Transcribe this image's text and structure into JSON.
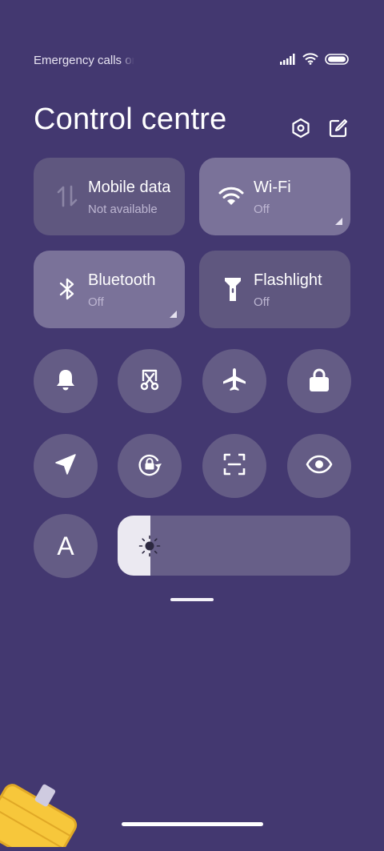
{
  "status_bar": {
    "carrier_text": "Emergency calls only",
    "icons": [
      "signal-icon",
      "wifi-icon",
      "battery-icon"
    ]
  },
  "header": {
    "title": "Control centre",
    "settings_icon": "settings-hexagon-icon",
    "edit_icon": "edit-icon"
  },
  "tiles": [
    {
      "label": "Mobile data",
      "status": "Not available",
      "icon": "mobile-data-icon",
      "active": false
    },
    {
      "label": "Wi-Fi",
      "status": "Off",
      "icon": "wifi-icon",
      "active": false
    },
    {
      "label": "Bluetooth",
      "status": "Off",
      "icon": "bluetooth-icon",
      "active": false
    },
    {
      "label": "Flashlight",
      "status": "Off",
      "icon": "flashlight-icon",
      "active": false
    }
  ],
  "toggles": [
    "bell-icon",
    "screenshot-icon",
    "airplane-icon",
    "lock-icon",
    "location-icon",
    "rotation-lock-icon",
    "scan-icon",
    "eye-icon"
  ],
  "font_toggle": {
    "label": "A",
    "icon": "font-size-icon"
  },
  "brightness": {
    "level": 0.14,
    "icon": "sun-icon"
  },
  "colors": {
    "background": "#433870",
    "tile_dim": "#5f577f",
    "tile_lit": "#7a7299",
    "round_button": "#645c85",
    "brightness_fill": "#ebe9f1"
  }
}
